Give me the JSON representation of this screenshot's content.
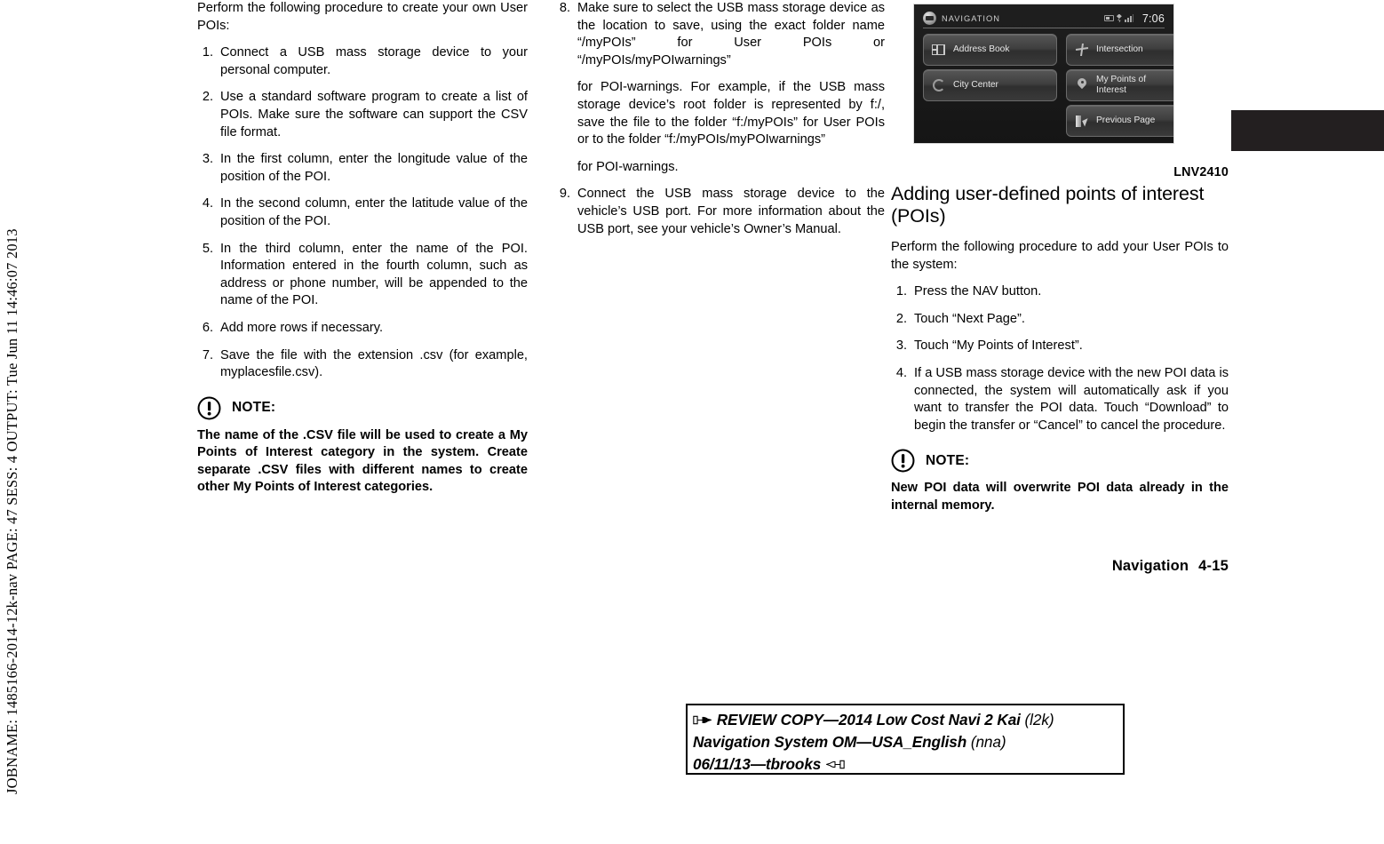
{
  "margin": {
    "jobname_line": "JOBNAME: 1485166-2014-12k-nav  PAGE: 47  SESS: 4  OUTPUT: Tue Jun 11 14:46:07 2013"
  },
  "column1": {
    "intro": "Perform the following procedure to create your own User POIs:",
    "steps": [
      {
        "num": "1.",
        "text": "Connect a USB mass storage device to your personal computer."
      },
      {
        "num": "2.",
        "text": "Use a standard software program to create a list of POIs. Make sure the software can support the CSV file format."
      },
      {
        "num": "3.",
        "text": "In the first column, enter the longitude value of the position of the POI."
      },
      {
        "num": "4.",
        "text": "In the second column, enter the latitude value of the position of the POI."
      },
      {
        "num": "5.",
        "text": "In the third column, enter the name of the POI. Information entered in the fourth column, such as address or phone number, will be appended to the name of the POI."
      },
      {
        "num": "6.",
        "text": "Add more rows if necessary."
      },
      {
        "num": "7.",
        "text": "Save the file with the extension .csv (for example, myplacesfile.csv)."
      }
    ],
    "note": {
      "icon": "exclamation-circle-icon",
      "label": "NOTE:",
      "body": "The name of the .CSV file will be used to create a My Points of Interest category in the system. Create separate .CSV files with different names to create other My Points of Interest categories."
    }
  },
  "column2": {
    "steps": [
      {
        "num": "8.",
        "text": "Make sure to select the USB mass storage device as the location to save, using the exact folder name “/myPOIs” for User POIs or “/myPOIs/myPOIwarnings”",
        "sub1": "for POI-warnings. For example, if the USB mass storage device’s root folder is represented by f:/, save the file to the folder “f:/myPOIs” for User POIs or to the folder “f:/myPOIs/myPOIwarnings”",
        "sub2": "for POI-warnings."
      },
      {
        "num": "9.",
        "text": "Connect the USB mass storage device to the vehicle’s USB port. For more information about the USB port, see your vehicle’s Owner’s Manual."
      }
    ]
  },
  "figure": {
    "caption": "LNV2410",
    "screen": {
      "title": "NAVIGATION",
      "time": "7:06",
      "status_icons": [
        "battery-icon",
        "bluetooth-icon",
        "signal-icon"
      ],
      "logo_icon": "navigation-logo-icon",
      "buttons": [
        {
          "id": "address-book",
          "label": "Address Book",
          "icon": "address-book-icon"
        },
        {
          "id": "intersection",
          "label": "Intersection",
          "icon": "intersection-icon"
        },
        {
          "id": "city-center",
          "label": "City Center",
          "icon": "city-center-icon"
        },
        {
          "id": "my-points-of-interest",
          "label": "My Points of\nInterest",
          "label_line1": "My Points of",
          "label_line2": "Interest",
          "icon": "map-pin-icon"
        },
        {
          "id": "previous-page",
          "label": "Previous Page",
          "icon": "previous-page-icon"
        }
      ]
    }
  },
  "column3": {
    "heading_line1": "Adding user-defined points of interest",
    "heading_line2": "(POIs)",
    "heading": "Adding user-defined points of interest (POIs)",
    "intro": "Perform the following procedure to add your User POIs to the system:",
    "steps": [
      {
        "num": "1.",
        "text": "Press the NAV button."
      },
      {
        "num": "2.",
        "text": "Touch “Next Page”."
      },
      {
        "num": "3.",
        "text": "Touch “My Points of Interest”."
      },
      {
        "num": "4.",
        "text": "If a USB mass storage device with the new POI data is connected, the system will automatically ask if you want to transfer the POI data. Touch “Download” to begin the transfer or “Cancel” to cancel the procedure."
      }
    ],
    "note": {
      "icon": "exclamation-circle-icon",
      "label": "NOTE:",
      "body": "New POI data will overwrite POI data already in the internal memory."
    }
  },
  "footer": {
    "section": "Navigation",
    "page": "4-15"
  },
  "review_stamp": {
    "hand_right_icon": "pointing-hand-right-icon",
    "hand_left_icon": "pointing-hand-left-icon",
    "line1_bold": "REVIEW COPY—2014 Low Cost Navi 2 Kai",
    "line1_tail": "(l2k)",
    "line2_bold": "Navigation System OM—USA_English",
    "line2_tail": "(nna)",
    "line3_bold": "06/11/13—tbrooks"
  },
  "colors": {
    "page_background": "#ffffff",
    "text": "#000000",
    "edge_tab": "#231f20",
    "screen_background": "#1c1c1c",
    "screen_button": "#3f3f3f",
    "screen_text": "#e6e6e6"
  }
}
